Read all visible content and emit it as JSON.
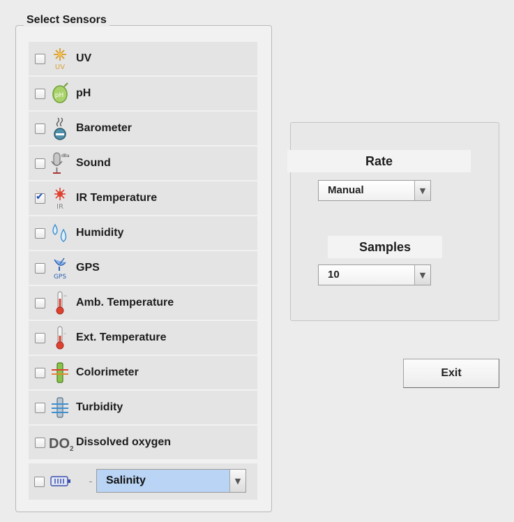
{
  "group_title": "Select Sensors",
  "sensors": [
    {
      "label": "UV",
      "icon": "uv-sun-icon",
      "checked": false
    },
    {
      "label": "pH",
      "icon": "ph-leaf-icon",
      "checked": false
    },
    {
      "label": "Barometer",
      "icon": "barometer-icon",
      "checked": false
    },
    {
      "label": "Sound",
      "icon": "microphone-icon",
      "checked": false
    },
    {
      "label": "IR Temperature",
      "icon": "ir-laser-icon",
      "checked": true
    },
    {
      "label": "Humidity",
      "icon": "water-drops-icon",
      "checked": false
    },
    {
      "label": "GPS",
      "icon": "satellite-dish-icon",
      "checked": false
    },
    {
      "label": "Amb. Temperature",
      "icon": "thermometer-icon",
      "checked": false
    },
    {
      "label": "Ext. Temperature",
      "icon": "ext-thermometer-icon",
      "checked": false
    },
    {
      "label": "Colorimeter",
      "icon": "colorimeter-tube-icon",
      "checked": false
    },
    {
      "label": "Turbidity",
      "icon": "turbidity-tube-icon",
      "checked": false
    },
    {
      "label": "Dissolved oxygen",
      "icon": "do2-icon",
      "checked": false
    }
  ],
  "icon_text": {
    "uv": "UV",
    "ir": "IR",
    "gps": "GPS",
    "dba": "dBa",
    "do2_main": "DO",
    "do2_sub": "2"
  },
  "salinity": {
    "checked": false,
    "icon": "conductivity-probe-icon",
    "selected": "Salinity"
  },
  "rate": {
    "title": "Rate",
    "selected": "Manual"
  },
  "samples": {
    "title": "Samples",
    "selected": "10"
  },
  "exit_label": "Exit",
  "colors": {
    "checkbox_check": "#1b4fb5",
    "salinity_highlight": "#b9d4f4"
  }
}
